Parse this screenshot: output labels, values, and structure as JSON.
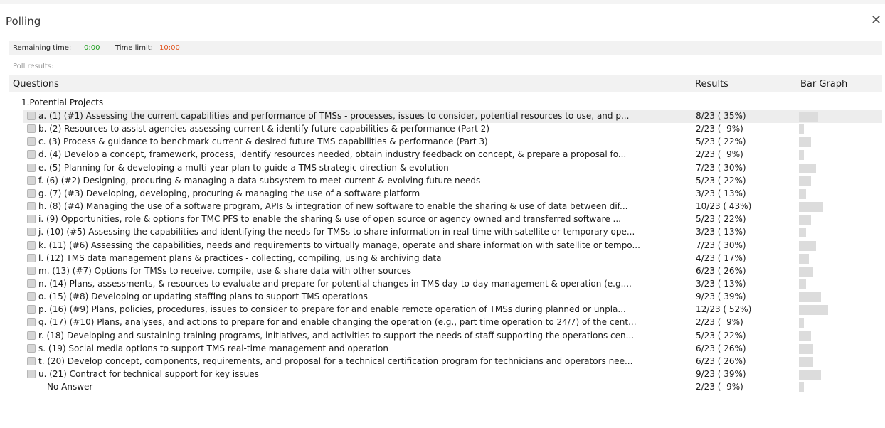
{
  "window": {
    "title": "Polling",
    "close_glyph": "✕"
  },
  "timer": {
    "remaining_label": "Remaining time:",
    "remaining_value": "0:00",
    "remaining_color": "#1e9e1e",
    "limit_label": "Time limit:",
    "limit_value": "10:00",
    "limit_color": "#e0501a"
  },
  "poll_results_label": "Poll results:",
  "columns": {
    "questions": "Questions",
    "results": "Results",
    "bar_graph": "Bar Graph"
  },
  "section": "1.Potential Projects",
  "total": 23,
  "options": [
    {
      "text": "a. (1) (#1) Assessing the current capabilities and performance of TMSs - processes, issues to consider, potential resources to use, and p...",
      "result": "8/23 ( 35%)",
      "count": 8,
      "highlighted": true
    },
    {
      "text": "b. (2) Resources to assist agencies assessing current & identify future capabilities & performance (Part 2)",
      "result": "2/23 (  9%)",
      "count": 2
    },
    {
      "text": "c. (3) Process & guidance to benchmark current & desired future TMS capabilities & performance (Part 3)",
      "result": "5/23 ( 22%)",
      "count": 5
    },
    {
      "text": "d. (4) Develop a concept, framework, process, identify resources needed, obtain industry feedback on concept, & prepare a proposal fo...",
      "result": "2/23 (  9%)",
      "count": 2
    },
    {
      "text": "e. (5) Planning for & developing a multi-year plan to guide a TMS strategic direction & evolution",
      "result": "7/23 ( 30%)",
      "count": 7
    },
    {
      "text": "f. (6) (#2) Designing, procuring & managing a data subsystem to meet current & evolving future needs",
      "result": "5/23 ( 22%)",
      "count": 5
    },
    {
      "text": "g. (7) (#3) Developing, developing, procuring & managing the use of a software platform",
      "result": "3/23 ( 13%)",
      "count": 3
    },
    {
      "text": "h. (8) (#4) Managing the use of a software program, APIs & integration of new software to enable the sharing & use of data between dif...",
      "result": "10/23 ( 43%)",
      "count": 10
    },
    {
      "text": "i. (9) Opportunities, role & options for TMC PFS to enable the sharing & use of open source or agency owned and transferred software ...",
      "result": "5/23 ( 22%)",
      "count": 5
    },
    {
      "text": "j. (10) (#5) Assessing the capabilities and identifying the needs for TMSs to share information in real-time with satellite or temporary ope...",
      "result": "3/23 ( 13%)",
      "count": 3
    },
    {
      "text": "k. (11) (#6) Assessing the capabilities, needs and requirements to virtually manage, operate and share information with satellite or tempo...",
      "result": "7/23 ( 30%)",
      "count": 7
    },
    {
      "text": "l. (12) TMS data management plans & practices - collecting, compiling, using & archiving data",
      "result": "4/23 ( 17%)",
      "count": 4
    },
    {
      "text": "m. (13) (#7) Options for TMSs to receive, compile, use & share data with other sources",
      "result": "6/23 ( 26%)",
      "count": 6
    },
    {
      "text": "n. (14) Plans, assessments, & resources to evaluate and prepare for potential changes in TMS day-to-day management & operation (e.g....",
      "result": "3/23 ( 13%)",
      "count": 3
    },
    {
      "text": "o. (15) (#8) Developing or updating staffing plans to support TMS operations",
      "result": "9/23 ( 39%)",
      "count": 9
    },
    {
      "text": "p. (16) (#9) Plans, policies, procedures, issues to consider to prepare for and enable remote operation of TMSs during planned or unpla...",
      "result": "12/23 ( 52%)",
      "count": 12
    },
    {
      "text": "q. (17) (#10) Plans, analyses, and actions to prepare for and enable changing the operation (e.g., part time operation to 24/7) of the cent...",
      "result": "2/23 (  9%)",
      "count": 2
    },
    {
      "text": "r. (18) Developing and sustaining training programs, initiatives, and activities to support the needs of staff supporting the operations cen...",
      "result": "5/23 ( 22%)",
      "count": 5
    },
    {
      "text": "s. (19) Social media options to support TMS real-time management and operation",
      "result": "6/23 ( 26%)",
      "count": 6
    },
    {
      "text": "t. (20) Develop concept, components, requirements, and proposal for a technical certification program for technicians and operators nee...",
      "result": "6/23 ( 26%)",
      "count": 6
    },
    {
      "text": "u. (21) Contract for technical support for key issues",
      "result": "9/23 ( 39%)",
      "count": 9
    }
  ],
  "no_answer": {
    "text": "No Answer",
    "result": "2/23 (  9%)",
    "count": 2
  }
}
